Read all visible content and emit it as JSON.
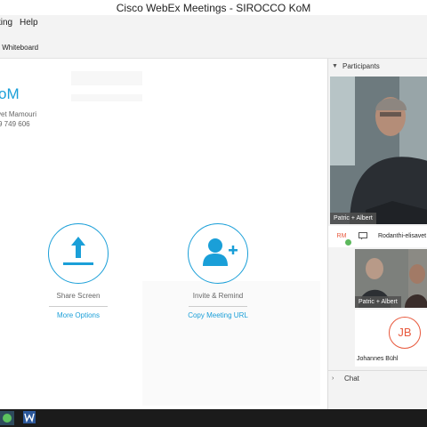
{
  "window": {
    "title": "Cisco WebEx Meetings - SIROCCO KoM"
  },
  "menu": {
    "items": [
      "ting",
      "Help"
    ]
  },
  "toolbar": {
    "whiteboard_label": "v Whiteboard"
  },
  "meeting": {
    "title_partial": "oM",
    "host_partial": "vet Mamouri",
    "phone_partial": "9 749 606"
  },
  "actions": {
    "share": {
      "label": "Share Screen",
      "link": "More Options"
    },
    "invite": {
      "label": "Invite & Remind",
      "link": "Copy Meeting URL"
    }
  },
  "participants": {
    "header": "Participants",
    "main_video_label": "Patric + Albert",
    "list": [
      {
        "initials": "RM",
        "name": "Rodanthi-elisavet"
      }
    ],
    "tile_label": "Patric + Albert",
    "avatar_initials": "JB",
    "avatar_name": "Johannes Bühl"
  },
  "chat": {
    "header": "Chat"
  },
  "colors": {
    "accent": "#1a9fd8",
    "avatar": "#e8593d",
    "taskbar": "#1b1b1b"
  }
}
